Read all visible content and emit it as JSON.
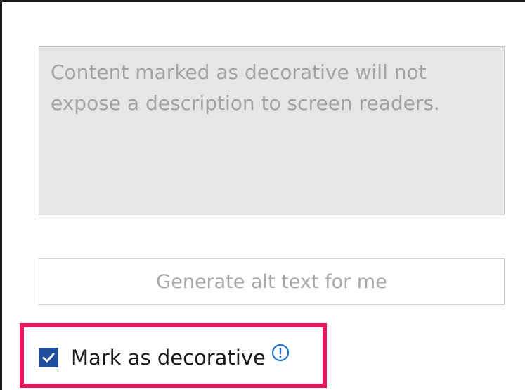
{
  "alt_text_panel": {
    "description_box": {
      "placeholder": "Content marked as decorative will not\nexpose a description to screen readers."
    },
    "generate_button": {
      "label": "Generate alt text for me",
      "enabled": false
    },
    "decorative_checkbox": {
      "label": "Mark as decorative",
      "checked": true,
      "info_icon": "info-circle-icon"
    }
  },
  "colors": {
    "highlight_border": "#e8175d",
    "checkbox_fill": "#1f4e9c",
    "info_icon": "#1f6fd1",
    "disabled_text": "#a3a3a3",
    "description_box_bg": "#e6e6e6"
  }
}
